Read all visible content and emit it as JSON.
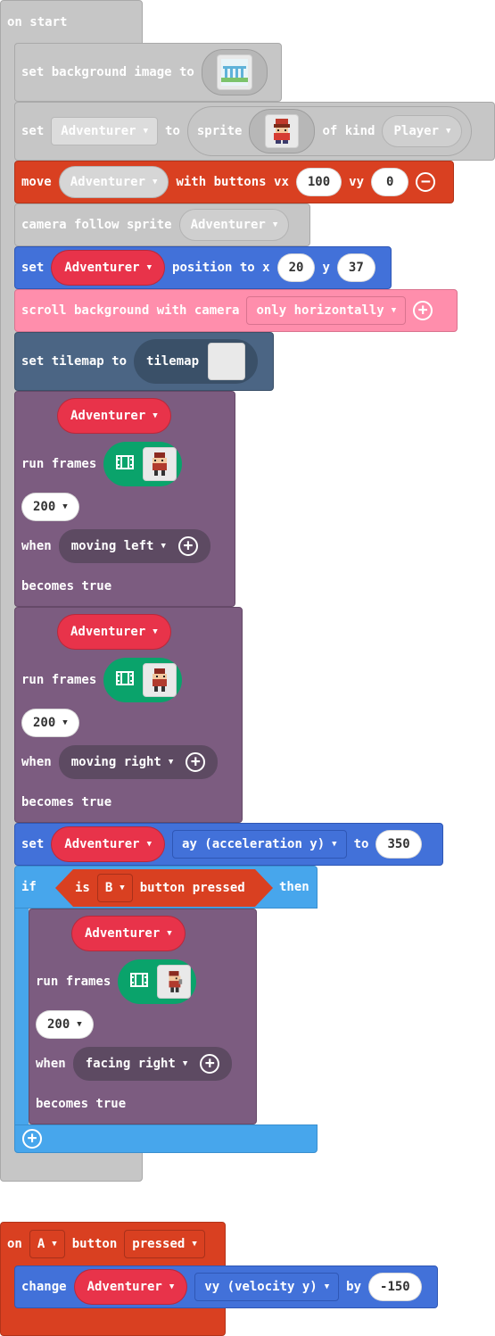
{
  "on_start": {
    "label": "on start"
  },
  "set_bg": {
    "label": "set background image to",
    "thumb_icon": "background-image-thumbnail"
  },
  "set_sprite": {
    "set": "set",
    "var": "Adventurer",
    "to": "to",
    "sprite": "sprite",
    "of_kind": "of kind",
    "kind": "Player",
    "thumb_icon": "adventurer-sprite-thumbnail"
  },
  "move": {
    "label": "move",
    "var": "Adventurer",
    "with": "with buttons vx",
    "vx": "100",
    "vy_label": "vy",
    "vy": "0"
  },
  "camera": {
    "label": "camera follow sprite",
    "var": "Adventurer"
  },
  "position": {
    "set": "set",
    "var": "Adventurer",
    "pos": "position to x",
    "x": "20",
    "y_label": "y",
    "y": "37"
  },
  "scroll": {
    "label": "scroll background with camera",
    "option": "only horizontally"
  },
  "tilemap": {
    "label": "set tilemap to",
    "value": "tilemap"
  },
  "anim1": {
    "var": "Adventurer",
    "run": "run frames",
    "interval": "200",
    "when": "when",
    "cond": "moving left",
    "becomes": "becomes true"
  },
  "anim2": {
    "var": "Adventurer",
    "run": "run frames",
    "interval": "200",
    "when": "when",
    "cond": "moving right",
    "becomes": "becomes true"
  },
  "set_ay": {
    "set": "set",
    "var": "Adventurer",
    "prop": "ay (acceleration y)",
    "to": "to",
    "value": "350"
  },
  "if_block": {
    "if": "if",
    "is": "is",
    "button": "B",
    "pressed": "button pressed",
    "then": "then"
  },
  "anim3": {
    "var": "Adventurer",
    "run": "run frames",
    "interval": "200",
    "when": "when",
    "cond": "facing right",
    "becomes": "becomes true"
  },
  "on_a": {
    "on": "on",
    "button": "A",
    "label": "button",
    "event": "pressed"
  },
  "change": {
    "label": "change",
    "var": "Adventurer",
    "prop": "vy (velocity y)",
    "by": "by",
    "value": "-150"
  },
  "colors": {
    "gray": "#c6c6c6",
    "orange": "#d94021",
    "blue": "#4271d9",
    "pink": "#ff8eac",
    "slate": "#4b6584",
    "purple": "#7c5c80",
    "lightblue": "#47a6ec",
    "red": "#e8334a",
    "green": "#0aa36b"
  }
}
